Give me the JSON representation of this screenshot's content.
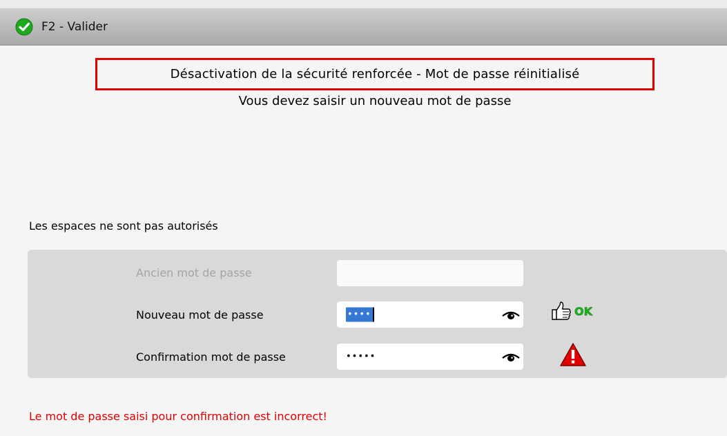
{
  "toolbar": {
    "validate_label": "F2 - Valider",
    "validate_icon": "check-circle-icon",
    "accent_color": "#1ea81e"
  },
  "header": {
    "title": "Désactivation de la sécurité renforcée - Mot de passe réinitialisé",
    "subtitle": "Vous devez saisir un nouveau mot de passe",
    "highlight_color": "#e00000"
  },
  "form": {
    "rule_text": "Les espaces ne sont pas autorisés",
    "fields": [
      {
        "label": "Ancien mot de passe",
        "value": "",
        "disabled": true
      },
      {
        "label": "Nouveau mot de passe",
        "value": "••••",
        "selected": true,
        "toggle_icon": "eye-icon",
        "status_icon": "thumbs-up-icon",
        "status_text": "OK"
      },
      {
        "label": "Confirmation mot de passe",
        "value": "•••••",
        "toggle_icon": "eye-icon",
        "status_icon": "warning-icon"
      }
    ]
  },
  "error": {
    "message": "Le mot de passe saisi pour confirmation est incorrect!",
    "color": "#e00000"
  }
}
